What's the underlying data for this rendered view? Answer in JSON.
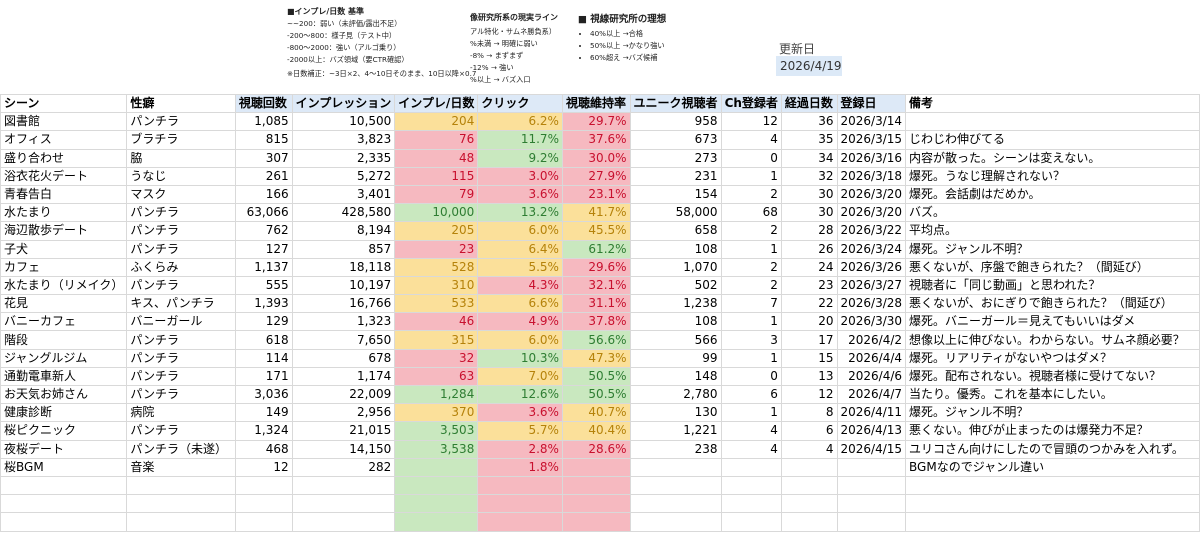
{
  "notes": {
    "impression_criteria": {
      "title": "■インプレ/日数 基準",
      "lines": [
        "~~200：弱い（未評価/露出不足）",
        "-200〜800：様子見（テスト中）",
        "-800〜2000：強い（アルゴ乗り）",
        "-2000以上：バズ領域（要CTR確認）"
      ],
      "correction": "※日数補正：~3日×2、4〜10日そのまま、10日以降×0.7"
    },
    "reality_line": {
      "title": "像研究所系の現実ライン",
      "sub": "アル特化・サムネ勝負系）",
      "lines": [
        "%未満 → 明確に弱い",
        "-8% → まずまず",
        "-12% → 強い",
        "%以上 → バズ入口"
      ]
    },
    "ideal": {
      "title": "■ 視線研究所の理想",
      "items": [
        "40%以上 →合格",
        "50%以上 →かなり強い",
        "60%超え →バズ候補"
      ]
    },
    "updated_label": "更新日",
    "updated_value": "2026/4/19"
  },
  "table": {
    "headers": [
      "シーン",
      "性癖",
      "視聴回数",
      "インプレッション",
      "インプレ/日数",
      "クリック",
      "視聴維持率",
      "ユニーク視聴者",
      "Ch登録者",
      "経過日数",
      "登録日",
      "備考"
    ],
    "rows": [
      {
        "scene": "図書館",
        "fetish": "パンチラ",
        "views": "1,085",
        "imps": "10,500",
        "ipd": "204",
        "ipd_c": "y",
        "ctr": "6.2%",
        "ctr_c": "y",
        "ret": "29.7%",
        "ret_c": "r",
        "uniq": "958",
        "subs": "12",
        "days": "36",
        "date": "2026/3/14",
        "memo": ""
      },
      {
        "scene": "オフィス",
        "fetish": "ブラチラ",
        "views": "815",
        "imps": "3,823",
        "ipd": "76",
        "ipd_c": "r",
        "ctr": "11.7%",
        "ctr_c": "g",
        "ret": "37.6%",
        "ret_c": "r",
        "uniq": "673",
        "subs": "4",
        "days": "35",
        "date": "2026/3/15",
        "memo": "じわじわ伸びてる"
      },
      {
        "scene": "盛り合わせ",
        "fetish": "脇",
        "views": "307",
        "imps": "2,335",
        "ipd": "48",
        "ipd_c": "r",
        "ctr": "9.2%",
        "ctr_c": "g",
        "ret": "30.0%",
        "ret_c": "r",
        "uniq": "273",
        "subs": "0",
        "days": "34",
        "date": "2026/3/16",
        "memo": "内容が散った。シーンは変えない。"
      },
      {
        "scene": "浴衣花火デート",
        "fetish": "うなじ",
        "views": "261",
        "imps": "5,272",
        "ipd": "115",
        "ipd_c": "r",
        "ctr": "3.0%",
        "ctr_c": "r",
        "ret": "27.9%",
        "ret_c": "r",
        "uniq": "231",
        "subs": "1",
        "days": "32",
        "date": "2026/3/18",
        "memo": "爆死。うなじ理解されない？"
      },
      {
        "scene": "青春告白",
        "fetish": "マスク",
        "views": "166",
        "imps": "3,401",
        "ipd": "79",
        "ipd_c": "r",
        "ctr": "3.6%",
        "ctr_c": "r",
        "ret": "23.1%",
        "ret_c": "r",
        "uniq": "154",
        "subs": "2",
        "days": "30",
        "date": "2026/3/20",
        "memo": "爆死。会話劇はだめか。"
      },
      {
        "scene": "水たまり",
        "fetish": "パンチラ",
        "views": "63,066",
        "imps": "428,580",
        "ipd": "10,000",
        "ipd_c": "g",
        "ctr": "13.2%",
        "ctr_c": "g",
        "ret": "41.7%",
        "ret_c": "y",
        "uniq": "58,000",
        "subs": "68",
        "days": "30",
        "date": "2026/3/20",
        "memo": "バズ。"
      },
      {
        "scene": "海辺散歩デート",
        "fetish": "パンチラ",
        "views": "762",
        "imps": "8,194",
        "ipd": "205",
        "ipd_c": "y",
        "ctr": "6.0%",
        "ctr_c": "y",
        "ret": "45.5%",
        "ret_c": "y",
        "uniq": "658",
        "subs": "2",
        "days": "28",
        "date": "2026/3/22",
        "memo": "平均点。"
      },
      {
        "scene": "子犬",
        "fetish": "パンチラ",
        "views": "127",
        "imps": "857",
        "ipd": "23",
        "ipd_c": "r",
        "ctr": "6.4%",
        "ctr_c": "y",
        "ret": "61.2%",
        "ret_c": "g",
        "uniq": "108",
        "subs": "1",
        "days": "26",
        "date": "2026/3/24",
        "memo": "爆死。ジャンル不明？"
      },
      {
        "scene": "カフェ",
        "fetish": "ふくらみ",
        "views": "1,137",
        "imps": "18,118",
        "ipd": "528",
        "ipd_c": "y",
        "ctr": "5.5%",
        "ctr_c": "y",
        "ret": "29.6%",
        "ret_c": "r",
        "uniq": "1,070",
        "subs": "2",
        "days": "24",
        "date": "2026/3/26",
        "memo": "悪くないが、序盤で飽きられた？（間延び）"
      },
      {
        "scene": "水たまり（リメイク）",
        "fetish": "パンチラ",
        "views": "555",
        "imps": "10,197",
        "ipd": "310",
        "ipd_c": "y",
        "ctr": "4.3%",
        "ctr_c": "r",
        "ret": "32.1%",
        "ret_c": "r",
        "uniq": "502",
        "subs": "2",
        "days": "23",
        "date": "2026/3/27",
        "memo": "視聴者に「同じ動画」と思われた？"
      },
      {
        "scene": "花見",
        "fetish": "キス、パンチラ",
        "views": "1,393",
        "imps": "16,766",
        "ipd": "533",
        "ipd_c": "y",
        "ctr": "6.6%",
        "ctr_c": "y",
        "ret": "31.1%",
        "ret_c": "r",
        "uniq": "1,238",
        "subs": "7",
        "days": "22",
        "date": "2026/3/28",
        "memo": "悪くないが、おにぎりで飽きられた？（間延び）"
      },
      {
        "scene": "バニーカフェ",
        "fetish": "バニーガール",
        "views": "129",
        "imps": "1,323",
        "ipd": "46",
        "ipd_c": "r",
        "ctr": "4.9%",
        "ctr_c": "r",
        "ret": "37.8%",
        "ret_c": "r",
        "uniq": "108",
        "subs": "1",
        "days": "20",
        "date": "2026/3/30",
        "memo": "爆死。バニーガール＝見えてもいいはダメ"
      },
      {
        "scene": "階段",
        "fetish": "パンチラ",
        "views": "618",
        "imps": "7,650",
        "ipd": "315",
        "ipd_c": "y",
        "ctr": "6.0%",
        "ctr_c": "y",
        "ret": "56.6%",
        "ret_c": "g",
        "uniq": "566",
        "subs": "3",
        "days": "17",
        "date": "2026/4/2",
        "memo": "想像以上に伸びない。わからない。サムネ顔必要？"
      },
      {
        "scene": "ジャングルジム",
        "fetish": "パンチラ",
        "views": "114",
        "imps": "678",
        "ipd": "32",
        "ipd_c": "r",
        "ctr": "10.3%",
        "ctr_c": "g",
        "ret": "47.3%",
        "ret_c": "y",
        "uniq": "99",
        "subs": "1",
        "days": "15",
        "date": "2026/4/4",
        "memo": "爆死。リアリティがないやつはダメ？"
      },
      {
        "scene": "通勤電車新人",
        "fetish": "パンチラ",
        "views": "171",
        "imps": "1,174",
        "ipd": "63",
        "ipd_c": "r",
        "ctr": "7.0%",
        "ctr_c": "y",
        "ret": "50.5%",
        "ret_c": "g",
        "uniq": "148",
        "subs": "0",
        "days": "13",
        "date": "2026/4/6",
        "memo": "爆死。配布されない。視聴者様に受けてない？"
      },
      {
        "scene": "お天気お姉さん",
        "fetish": "パンチラ",
        "views": "3,036",
        "imps": "22,009",
        "ipd": "1,284",
        "ipd_c": "g",
        "ctr": "12.6%",
        "ctr_c": "g",
        "ret": "50.5%",
        "ret_c": "g",
        "uniq": "2,780",
        "subs": "6",
        "days": "12",
        "date": "2026/4/7",
        "memo": "当たり。優秀。これを基本にしたい。"
      },
      {
        "scene": "健康診断",
        "fetish": "病院",
        "views": "149",
        "imps": "2,956",
        "ipd": "370",
        "ipd_c": "y",
        "ctr": "3.6%",
        "ctr_c": "r",
        "ret": "40.7%",
        "ret_c": "y",
        "uniq": "130",
        "subs": "1",
        "days": "8",
        "date": "2026/4/11",
        "memo": "爆死。ジャンル不明？"
      },
      {
        "scene": "桜ピクニック",
        "fetish": "パンチラ",
        "views": "1,324",
        "imps": "21,015",
        "ipd": "3,503",
        "ipd_c": "g",
        "ctr": "5.7%",
        "ctr_c": "y",
        "ret": "40.4%",
        "ret_c": "y",
        "uniq": "1,221",
        "subs": "4",
        "days": "6",
        "date": "2026/4/13",
        "memo": "悪くない。伸びが止まったのは爆発力不足？"
      },
      {
        "scene": "夜桜デート",
        "fetish": "パンチラ（未遂）",
        "views": "468",
        "imps": "14,150",
        "ipd": "3,538",
        "ipd_c": "g",
        "ctr": "2.8%",
        "ctr_c": "r",
        "ret": "28.6%",
        "ret_c": "r",
        "uniq": "238",
        "subs": "4",
        "days": "4",
        "date": "2026/4/15",
        "memo": "ユリコさん向けにしたので冒頭のつかみを入れず。"
      },
      {
        "scene": "桜BGM",
        "fetish": "音楽",
        "views": "12",
        "imps": "282",
        "ipd": "",
        "ipd_c": "g",
        "ctr": "1.8%",
        "ctr_c": "r",
        "ret": "",
        "ret_c": "r",
        "uniq": "",
        "subs": "",
        "days": "",
        "date": "",
        "memo": "BGMなのでジャンル違い"
      },
      {
        "scene": "",
        "fetish": "",
        "views": "",
        "imps": "",
        "ipd": "",
        "ipd_c": "g",
        "ctr": "",
        "ctr_c": "r",
        "ret": "",
        "ret_c": "r",
        "uniq": "",
        "subs": "",
        "days": "",
        "date": "",
        "memo": ""
      },
      {
        "scene": "",
        "fetish": "",
        "views": "",
        "imps": "",
        "ipd": "",
        "ipd_c": "g",
        "ctr": "",
        "ctr_c": "r",
        "ret": "",
        "ret_c": "r",
        "uniq": "",
        "subs": "",
        "days": "",
        "date": "",
        "memo": ""
      },
      {
        "scene": "",
        "fetish": "",
        "views": "",
        "imps": "",
        "ipd": "",
        "ipd_c": "g",
        "ctr": "",
        "ctr_c": "r",
        "ret": "",
        "ret_c": "r",
        "uniq": "",
        "subs": "",
        "days": "",
        "date": "",
        "memo": ""
      }
    ]
  }
}
